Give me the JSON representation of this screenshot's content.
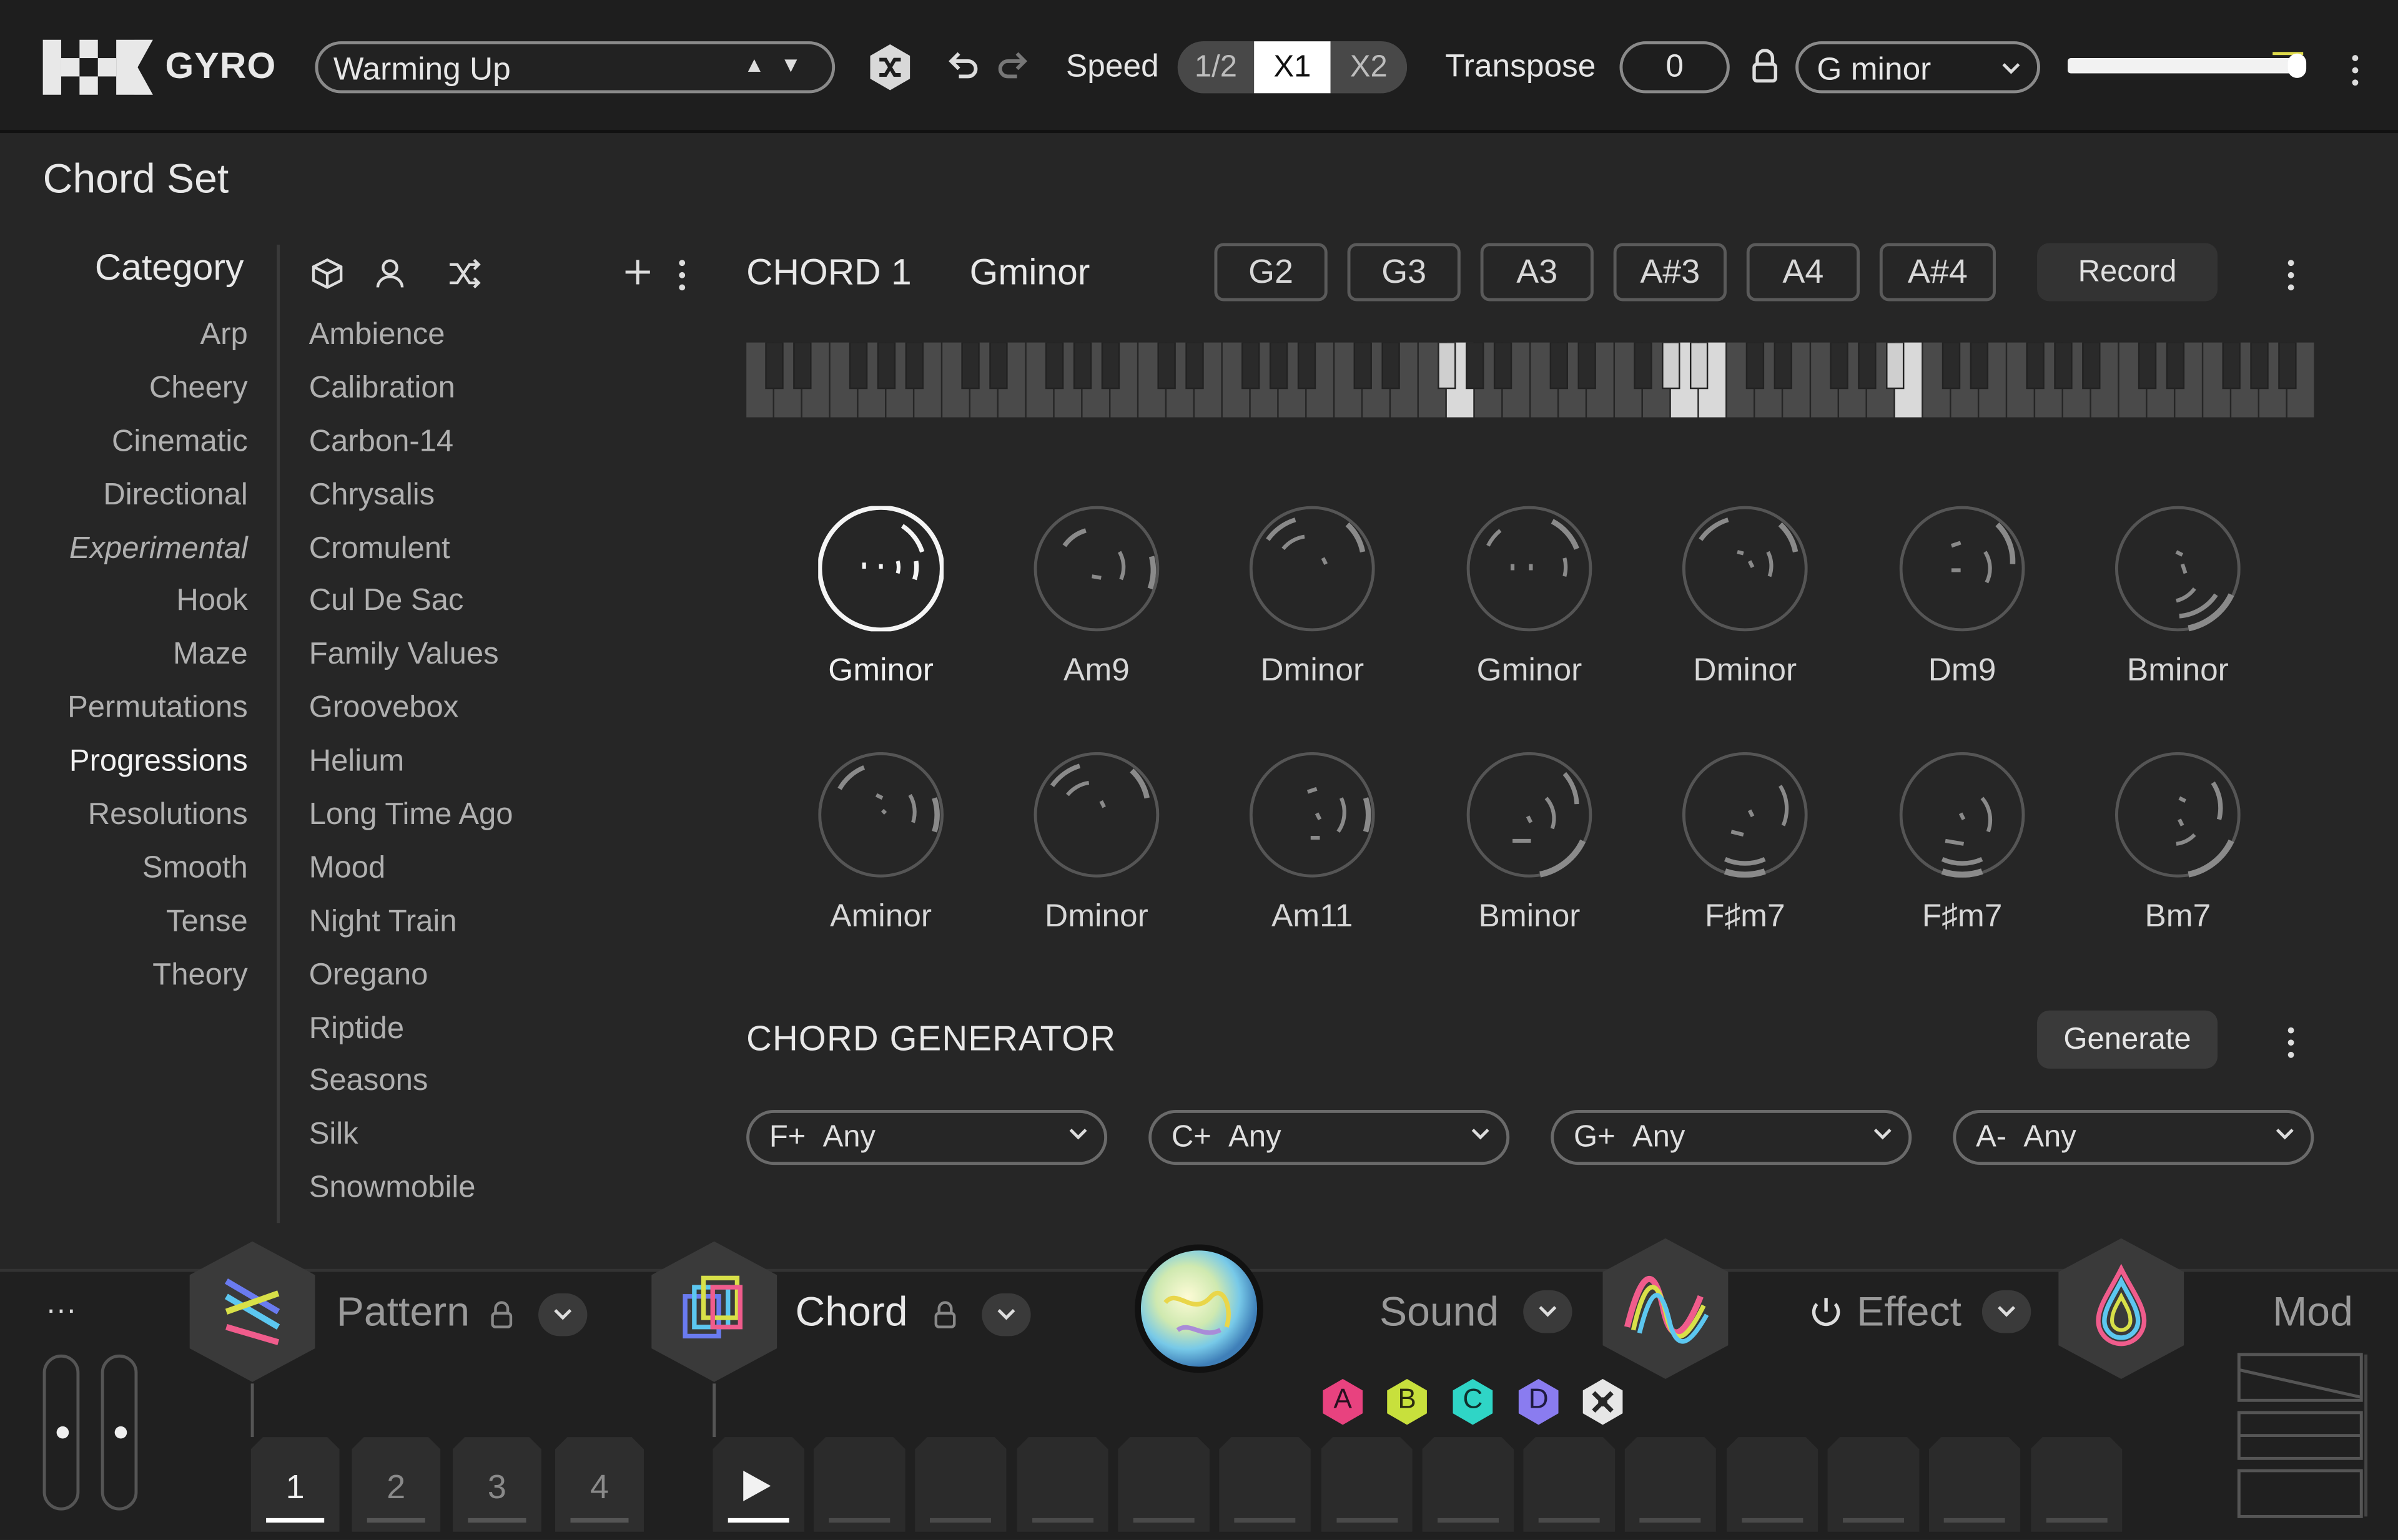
{
  "app": {
    "name": "GYRO"
  },
  "topbar": {
    "preset_name": "Warming Up",
    "speed_label": "Speed",
    "speed_options": [
      "1/2",
      "X1",
      "X2"
    ],
    "speed_selected": "X1",
    "transpose_label": "Transpose",
    "transpose_value": "0",
    "key_value": "G minor",
    "volume_level": 0.95
  },
  "chord_set": {
    "title": "Chord Set",
    "category_header": "Category",
    "categories": [
      "Arp",
      "Cheery",
      "Cinematic",
      "Directional",
      "Experimental",
      "Hook",
      "Maze",
      "Permutations",
      "Progressions",
      "Resolutions",
      "Smooth",
      "Tense",
      "Theory"
    ],
    "selected_category": "Progressions",
    "presets": [
      "Ambience",
      "Calibration",
      "Carbon-14",
      "Chrysalis",
      "Cromulent",
      "Cul De Sac",
      "Family Values",
      "Groovebox",
      "Helium",
      "Long Time Ago",
      "Mood",
      "Night Train",
      "Oregano",
      "Riptide",
      "Seasons",
      "Silk",
      "Snowmobile"
    ]
  },
  "chord_editor": {
    "chord_label": "CHORD 1",
    "chord_name": "Gminor",
    "notes": [
      "G2",
      "G3",
      "A3",
      "A#3",
      "A4",
      "A#4"
    ],
    "record_label": "Record",
    "chords_row1": [
      "Gminor",
      "Am9",
      "Dminor",
      "Gminor",
      "Dminor",
      "Dm9",
      "Bminor"
    ],
    "chords_row2": [
      "Aminor",
      "Dminor",
      "Am11",
      "Bminor",
      "F♯m7",
      "F♯m7",
      "Bm7"
    ],
    "selected_chord_index": 0
  },
  "generator": {
    "title": "CHORD GENERATOR",
    "generate_label": "Generate",
    "slots": [
      {
        "prefix": "F+",
        "value": "Any"
      },
      {
        "prefix": "C+",
        "value": "Any"
      },
      {
        "prefix": "G+",
        "value": "Any"
      },
      {
        "prefix": "A-",
        "value": "Any"
      }
    ]
  },
  "bottom": {
    "more_label": "···",
    "pattern_label": "Pattern",
    "chord_label": "Chord",
    "sound_label": "Sound",
    "effect_label": "Effect",
    "mod_label": "Mod",
    "pattern_tabs": [
      "1",
      "2",
      "3",
      "4"
    ],
    "pattern_selected": "1",
    "variation_letters": [
      "A",
      "B",
      "C",
      "D"
    ]
  },
  "colors": {
    "bg": "#262626",
    "topbar": "#1e1e1e",
    "accent_a": "#e8427f",
    "accent_b": "#c8e03c",
    "accent_c": "#2fd5c6",
    "accent_d": "#8a7cf0"
  }
}
